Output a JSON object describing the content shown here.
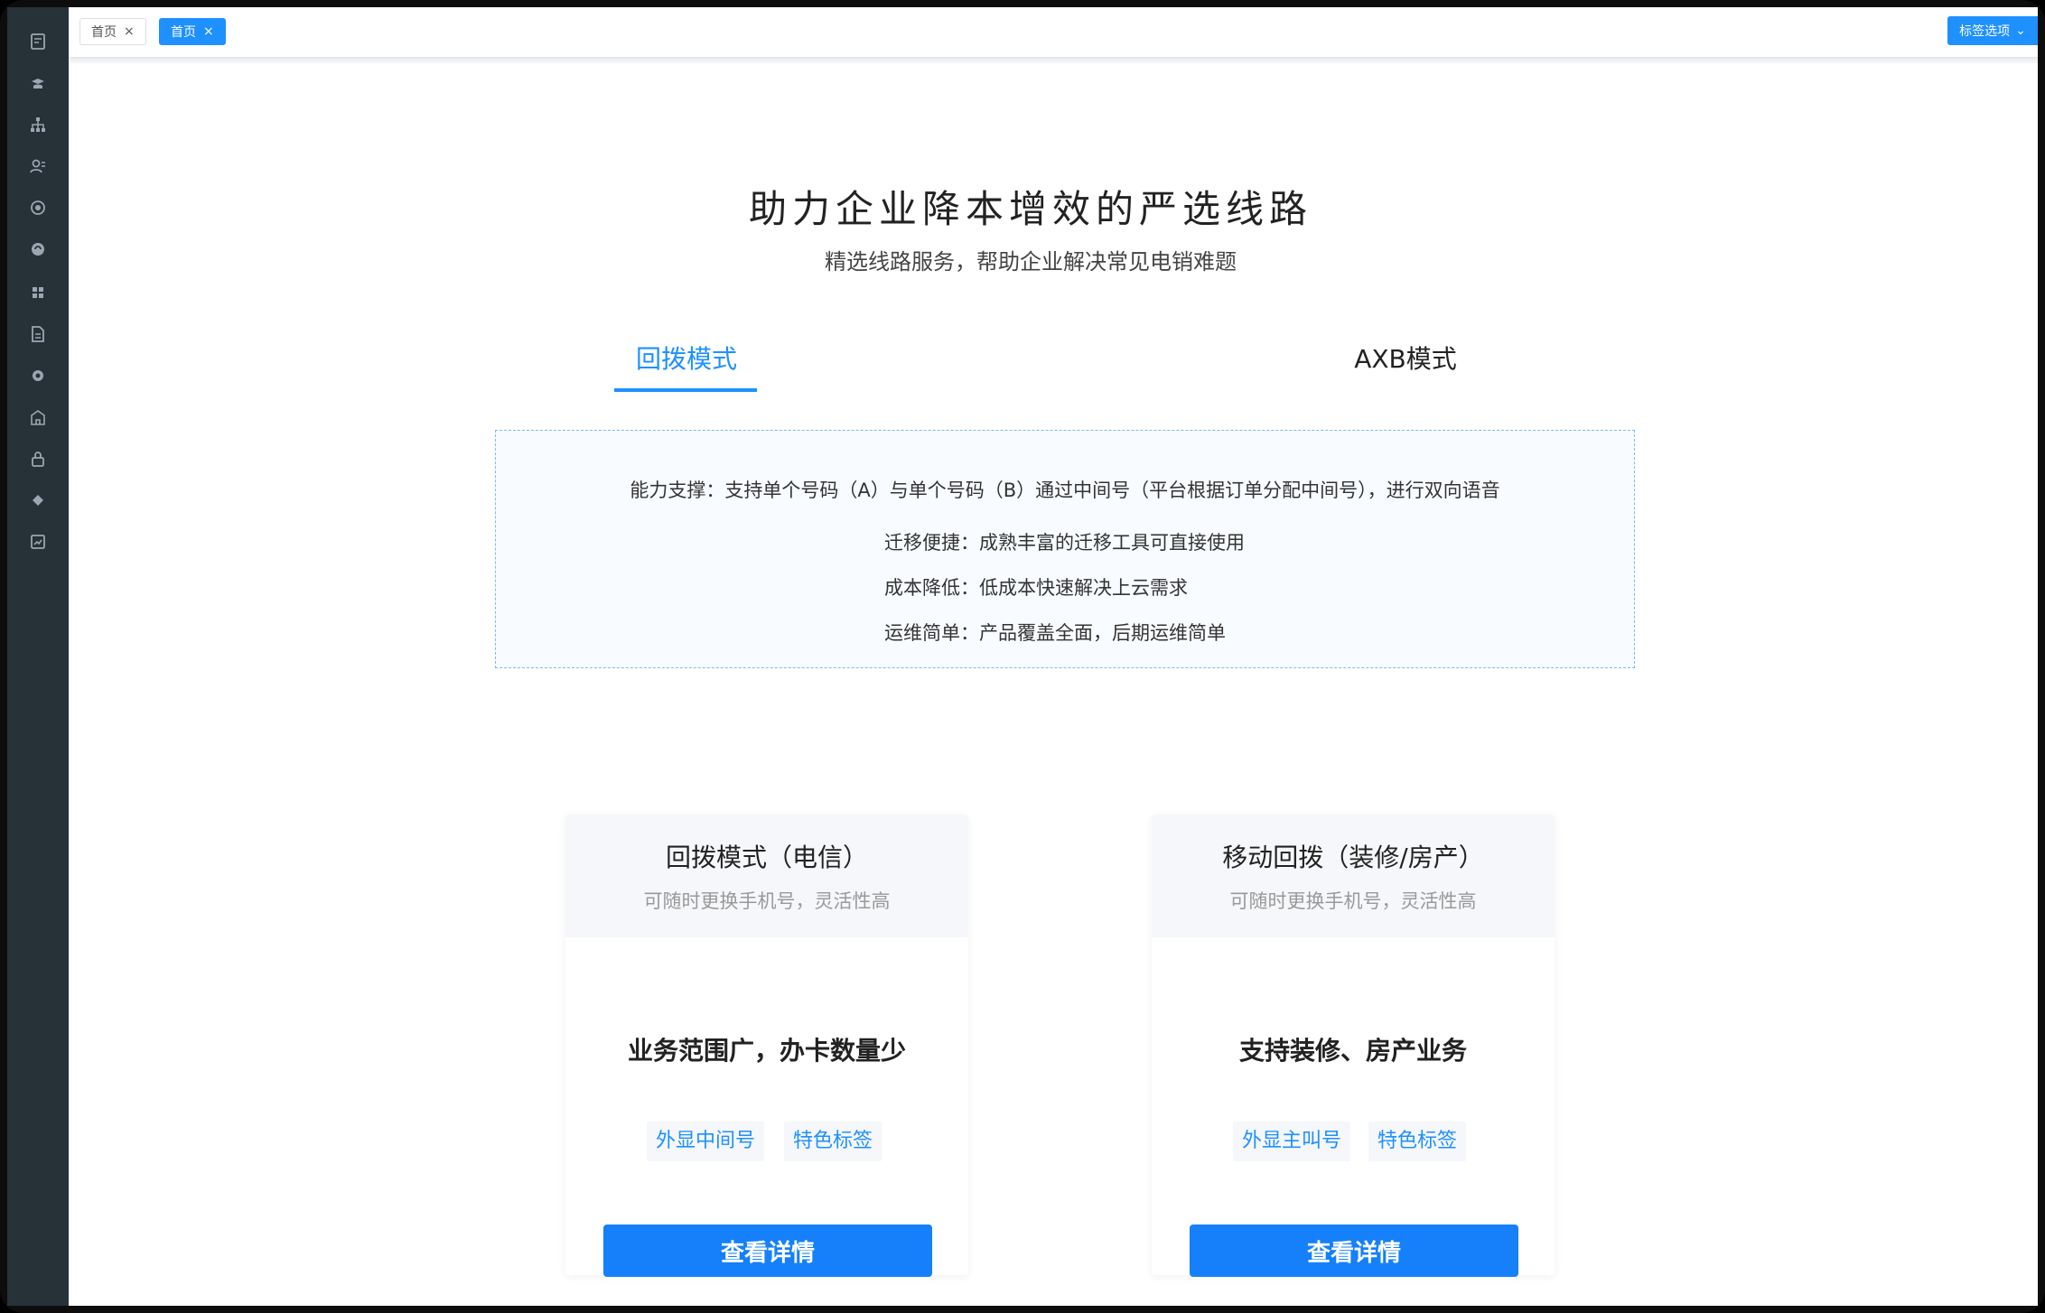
{
  "tabs": [
    {
      "label": "首页",
      "active": false
    },
    {
      "label": "首页",
      "active": true
    }
  ],
  "tab_options_label": "标签选项",
  "hero": {
    "title": "助力企业降本增效的严选线路",
    "subtitle": "精选线路服务，帮助企业解决常见电销难题"
  },
  "mode_tabs": [
    {
      "label": "回拨模式",
      "active": true
    },
    {
      "label": "AXB模式",
      "active": false
    }
  ],
  "info": {
    "line1": "能力支撑：支持单个号码（A）与单个号码（B）通过中间号（平台根据订单分配中间号），进行双向语音",
    "line2": "迁移便捷：成熟丰富的迁移工具可直接使用",
    "line3": "成本降低：低成本快速解决上云需求",
    "line4": "运维简单：产品覆盖全面，后期运维简单"
  },
  "cards": [
    {
      "title": "回拨模式（电信）",
      "subtitle": "可随时更换手机号，灵活性高",
      "feature": "业务范围广，办卡数量少",
      "pills": [
        "外显中间号",
        "特色标签"
      ],
      "button": "查看详情"
    },
    {
      "title": "移动回拨（装修/房产）",
      "subtitle": "可随时更换手机号，灵活性高",
      "feature": "支持装修、房产业务",
      "pills": [
        "外显主叫号",
        "特色标签"
      ],
      "button": "查看详情"
    }
  ],
  "sidebar_icons": [
    "dashboard-icon",
    "user-hat-icon",
    "org-tree-icon",
    "contacts-icon",
    "clock-icon",
    "refresh-icon",
    "grid-icon",
    "document-icon",
    "gear-icon",
    "building-icon",
    "lock-icon",
    "diamond-icon",
    "chart-icon"
  ],
  "colors": {
    "accent": "#1e90ff",
    "sidebar": "#263138"
  }
}
